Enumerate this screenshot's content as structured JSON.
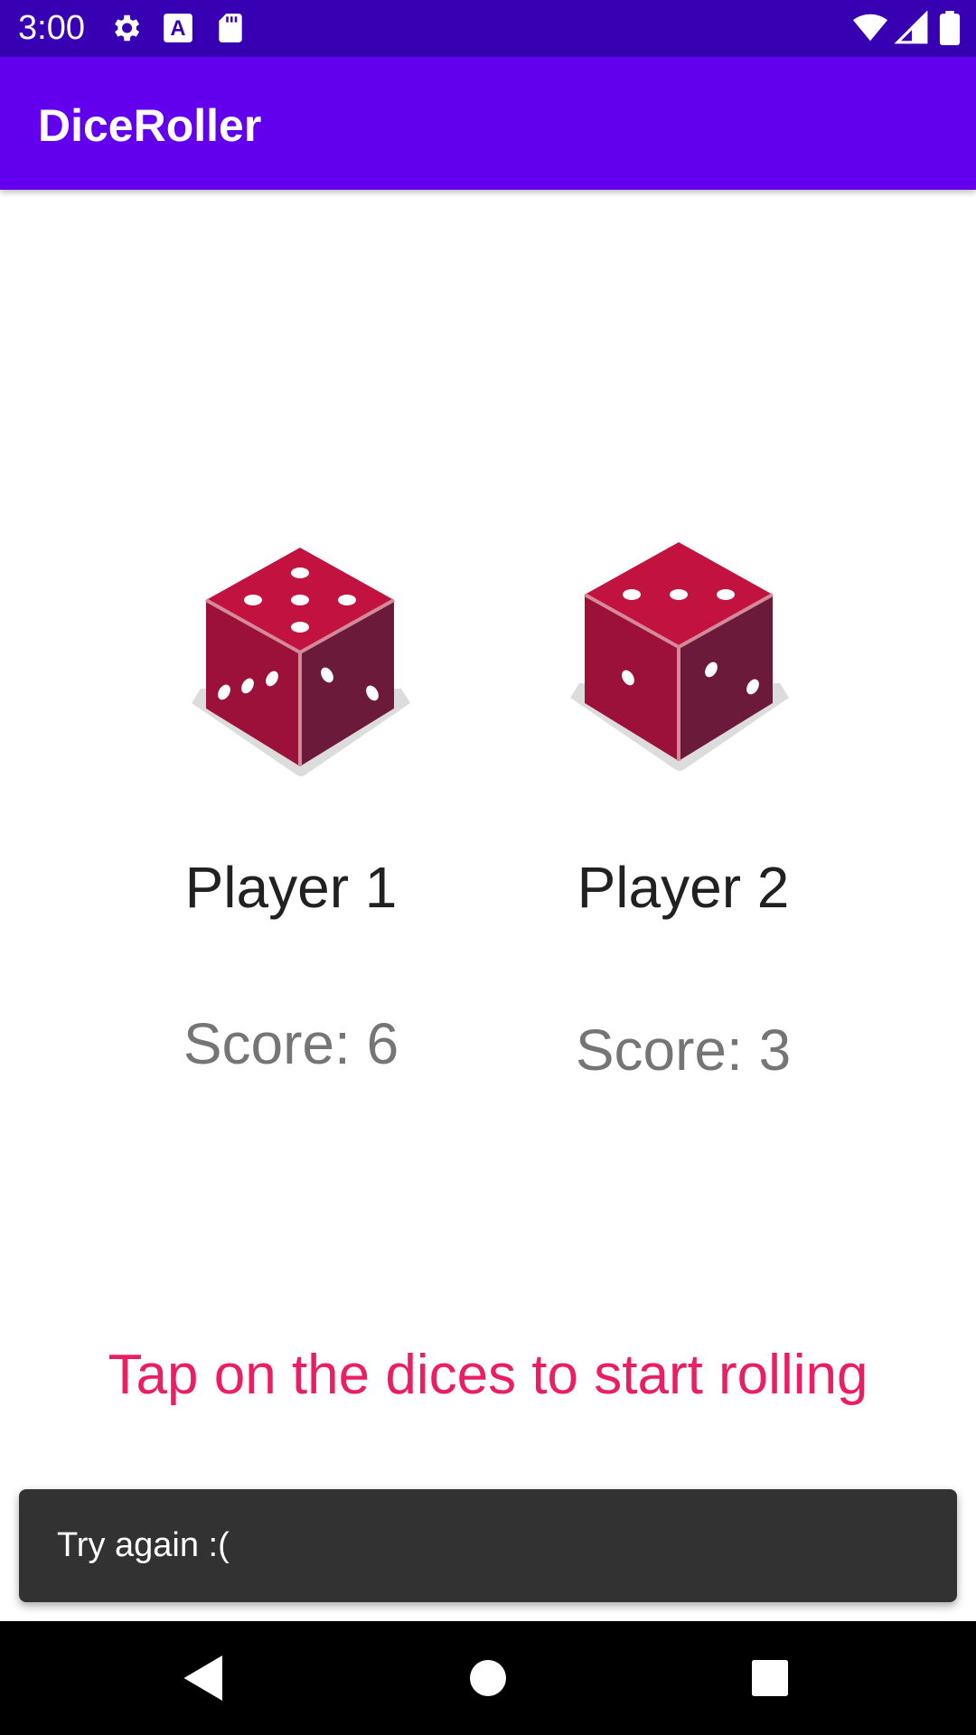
{
  "status_bar": {
    "time": "3:00",
    "icons": [
      "settings-icon",
      "text-a-icon",
      "sd-card-icon",
      "wifi-icon",
      "cell-signal-icon",
      "battery-icon"
    ]
  },
  "app_bar": {
    "title": "DiceRoller"
  },
  "players": [
    {
      "label": "Player 1",
      "score_text": "Score: 6",
      "die_icon": "die-five-icon"
    },
    {
      "label": "Player 2",
      "score_text": "Score: 3",
      "die_icon": "die-three-icon"
    }
  ],
  "hint": "Tap on the dices to start rolling",
  "snackbar": {
    "message": "Try again :("
  },
  "nav_bar": {
    "icons": [
      "back-icon",
      "home-icon",
      "recents-icon"
    ]
  },
  "colors": {
    "status_bar": "#3700b3",
    "app_bar": "#6200ee",
    "hint": "#e91e63",
    "die_top": "#c2123f",
    "die_left": "#9c1139",
    "die_right": "#6b1a3a"
  }
}
